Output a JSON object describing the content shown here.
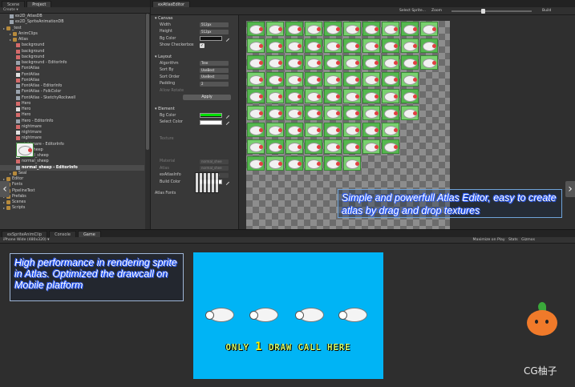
{
  "left_panel": {
    "tabs": [
      "Scene",
      "Project"
    ],
    "create_label": "Create ▾",
    "tree": [
      {
        "label": "ex2D_AtlasDB",
        "icon": "file-icon",
        "depth": 1
      },
      {
        "label": "ex2D_SpriteAnimationDB",
        "icon": "file-icon",
        "depth": 1
      },
      {
        "label": "_test",
        "icon": "folder-icon",
        "depth": 0
      },
      {
        "label": "AnimClips",
        "icon": "folder-icon",
        "depth": 1
      },
      {
        "label": "Atlas",
        "icon": "folder-icon",
        "depth": 1
      },
      {
        "label": "background",
        "icon": "image-icon",
        "depth": 2
      },
      {
        "label": "background",
        "icon": "image-icon",
        "depth": 2
      },
      {
        "label": "background",
        "icon": "image-icon",
        "depth": 2
      },
      {
        "label": "background - EditorInfo",
        "icon": "file-icon",
        "depth": 2
      },
      {
        "label": "FontAtlas",
        "icon": "image-icon",
        "depth": 2
      },
      {
        "label": "FontAtlas",
        "icon": "font-icon",
        "depth": 2
      },
      {
        "label": "FontAtlas",
        "icon": "image-icon",
        "depth": 2
      },
      {
        "label": "FontAtlas - EditorInfo",
        "icon": "file-icon",
        "depth": 2
      },
      {
        "label": "FontAtlas - FolkColor",
        "icon": "file-icon",
        "depth": 2
      },
      {
        "label": "FontAtlas - SketchyRockwell",
        "icon": "file-icon",
        "depth": 2
      },
      {
        "label": "Hero",
        "icon": "image-icon",
        "depth": 2
      },
      {
        "label": "Hero",
        "icon": "font-icon",
        "depth": 2
      },
      {
        "label": "Hero",
        "icon": "image-icon",
        "depth": 2
      },
      {
        "label": "Hero - EditorInfo",
        "icon": "file-icon",
        "depth": 2
      },
      {
        "label": "nightmare",
        "icon": "image-icon",
        "depth": 2
      },
      {
        "label": "nightmare",
        "icon": "font-icon",
        "depth": 2
      },
      {
        "label": "nightmare",
        "icon": "image-icon",
        "depth": 2
      },
      {
        "label": "nightmare - EditorInfo",
        "icon": "file-icon",
        "depth": 2
      },
      {
        "label": "normal_sheep",
        "icon": "sheep-icon",
        "depth": 2
      },
      {
        "label": "normal_sheep",
        "icon": "font-icon",
        "depth": 2
      },
      {
        "label": "normal_sheep",
        "icon": "image-icon",
        "depth": 2
      },
      {
        "label": "normal_sheep - EditorInfo",
        "icon": "file-icon",
        "depth": 2,
        "selected": true
      },
      {
        "label": "Seal",
        "icon": "folder-icon",
        "depth": 1
      },
      {
        "label": "Editor",
        "icon": "folder-icon",
        "depth": 0
      },
      {
        "label": "Fonts",
        "icon": "folder-icon",
        "depth": 0
      },
      {
        "label": "PipelineText",
        "icon": "folder-icon",
        "depth": 0
      },
      {
        "label": "Prefabs",
        "icon": "folder-icon",
        "depth": 0
      },
      {
        "label": "Scenes",
        "icon": "folder-icon",
        "depth": 0
      },
      {
        "label": "Scripts",
        "icon": "folder-icon",
        "depth": 0
      }
    ]
  },
  "editor": {
    "tab": "exAtlasEditor",
    "toolbar": {
      "select_label": "Select Sprite...",
      "zoom_label": "Zoom",
      "build_label": "Build"
    },
    "canvas_section": {
      "title": "Canvas",
      "width_label": "Width",
      "width_value": "512px",
      "height_label": "Height",
      "height_value": "512px",
      "bg_color_label": "Bg Color",
      "show_checkerboard_label": "Show Checkerbox",
      "show_checkerboard_checked": true
    },
    "layout_section": {
      "title": "Layout",
      "algorithm_label": "Algorithm",
      "algorithm_value": "Tree",
      "sort_by_label": "Sort By",
      "sort_by_value": "UseBest",
      "sort_order_label": "Sort Order",
      "sort_order_value": "UseBest",
      "padding_label": "Padding",
      "padding_value": "2",
      "allow_rotate_label": "Allow Rotate",
      "apply_label": "Apply"
    },
    "element_section": {
      "title": "Element",
      "bg_color_label": "Bg Color",
      "select_color_label": "Select Color"
    },
    "texture_label": "Texture",
    "material_label": "Material",
    "material_value": "normal_shee",
    "atlas_label": "Atlas",
    "atlas_value": "normal_shee",
    "exatlasinfo_label": "exAtlasInfo",
    "exatlasinfo_value": "normal_she",
    "build_color_label": "Build Color",
    "atlas_fonts_label": "Atlas Fonts",
    "annotation": "Simple and powerfull Atlas Editor, easy to create atlas by drag and drop textures"
  },
  "bottom": {
    "tabs": [
      "exSpriteAnimClip",
      "Console",
      "Game"
    ],
    "resolution_label": "iPhone Wide (480x320) ▾",
    "maximize_label": "Maximize on Play",
    "stats_label": "Stats",
    "gizmos_label": "Gizmos",
    "annotation": "High performance in rendering sprite in Atlas. Optimized the drawcall on Mobile platform",
    "game_caption_prefix": "ONLY",
    "game_caption_number": "1",
    "game_caption_suffix": "DRAW CALL HERE",
    "game_background": "#00b4f5"
  },
  "watermark": "CG柚子",
  "nav": {
    "left": "‹",
    "right": "›"
  }
}
